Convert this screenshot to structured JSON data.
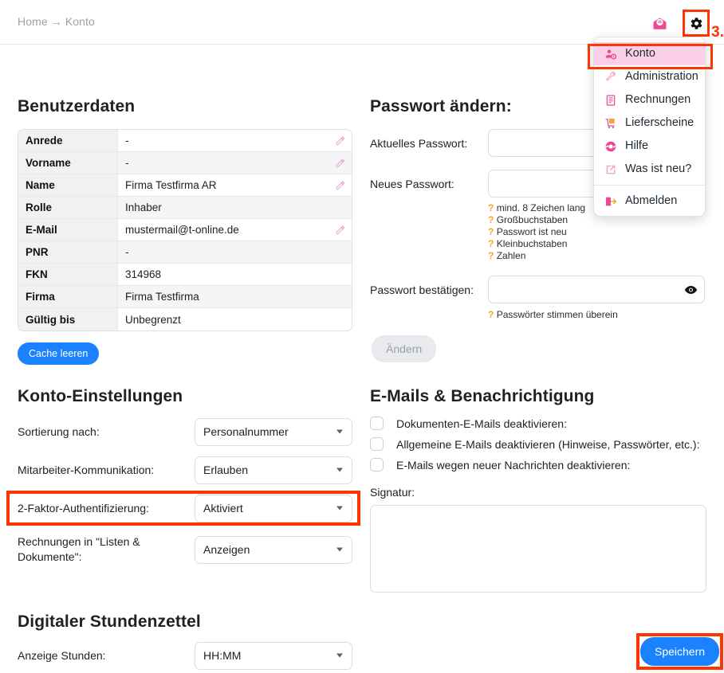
{
  "header": {
    "breadcrumb": "Home → Konto",
    "mail_icon": "mail-open-icon",
    "gear_icon": "gear-icon",
    "step_marker": "3."
  },
  "account_menu": {
    "items": [
      {
        "label": "Konto",
        "icon": "user-gear-icon",
        "active": true
      },
      {
        "label": "Administration",
        "icon": "wrench-icon",
        "active": false
      },
      {
        "label": "Rechnungen",
        "icon": "receipt-icon",
        "active": false
      },
      {
        "label": "Lieferscheine",
        "icon": "delivery-cart-icon",
        "active": false
      },
      {
        "label": "Hilfe",
        "icon": "lifebuoy-icon",
        "active": false
      },
      {
        "label": "Was ist neu?",
        "icon": "external-link-icon",
        "active": false
      }
    ],
    "logout": {
      "label": "Abmelden",
      "icon": "logout-icon"
    }
  },
  "user_data": {
    "title": "Benutzerdaten",
    "rows": [
      {
        "key": "Anrede",
        "value": "-",
        "editable": true
      },
      {
        "key": "Vorname",
        "value": "-",
        "editable": true
      },
      {
        "key": "Name",
        "value": "Firma Testfirma AR",
        "editable": true
      },
      {
        "key": "Rolle",
        "value": "Inhaber",
        "editable": false
      },
      {
        "key": "E-Mail",
        "value": "mustermail@t-online.de",
        "editable": true
      },
      {
        "key": "PNR",
        "value": "-",
        "editable": false
      },
      {
        "key": "FKN",
        "value": "314968",
        "editable": false
      },
      {
        "key": "Firma",
        "value": "Firma Testfirma",
        "editable": false
      },
      {
        "key": "Gültig bis",
        "value": "Unbegrenzt",
        "editable": false
      }
    ],
    "cache_button": "Cache leeren"
  },
  "password": {
    "title": "Passwort ändern:",
    "current_label": "Aktuelles Passwort:",
    "current_value": "",
    "new_label": "Neues Passwort:",
    "new_value": "",
    "confirm_label": "Passwort bestätigen:",
    "confirm_value": "",
    "hints": [
      "mind. 8 Zeichen lang",
      "Großbuchstaben",
      "Passwort ist neu",
      "Kleinbuchstaben",
      "Zahlen"
    ],
    "match_hint": "Passwörter stimmen überein",
    "submit_label": "Ändern"
  },
  "account_settings": {
    "title": "Konto-Einstellungen",
    "rows": [
      {
        "label": "Sortierung nach:",
        "value": "Personalnummer",
        "highlight": false
      },
      {
        "label": "Mitarbeiter-Kommunikation:",
        "value": "Erlauben",
        "highlight": false
      },
      {
        "label": "2-Faktor-Authentifizierung:",
        "value": "Aktiviert",
        "highlight": true
      },
      {
        "label": "Rechnungen in \"Listen & Dokumente\":",
        "value": "Anzeigen",
        "highlight": false
      }
    ]
  },
  "emails": {
    "title": "E-Mails & Benachrichtigung",
    "checkboxes": [
      {
        "label": "Dokumenten-E-Mails deaktivieren:",
        "checked": false
      },
      {
        "label": "Allgemeine E-Mails deaktivieren (Hinweise, Passwörter, etc.):",
        "checked": false
      },
      {
        "label": "E-Mails wegen neuer Nachrichten deaktivieren:",
        "checked": false
      }
    ],
    "signature_label": "Signatur:",
    "signature_value": ""
  },
  "timesheet": {
    "title": "Digitaler Stundenzettel",
    "label": "Anzeige Stunden:",
    "value": "HH:MM"
  },
  "save": {
    "label": "Speichern"
  },
  "colors": {
    "accent_blue": "#1a82ff",
    "highlight_red": "#fc3503",
    "menu_pink": "#fbcfe8",
    "icon_pink": "#ec4899",
    "hint_orange": "#f5a623"
  }
}
